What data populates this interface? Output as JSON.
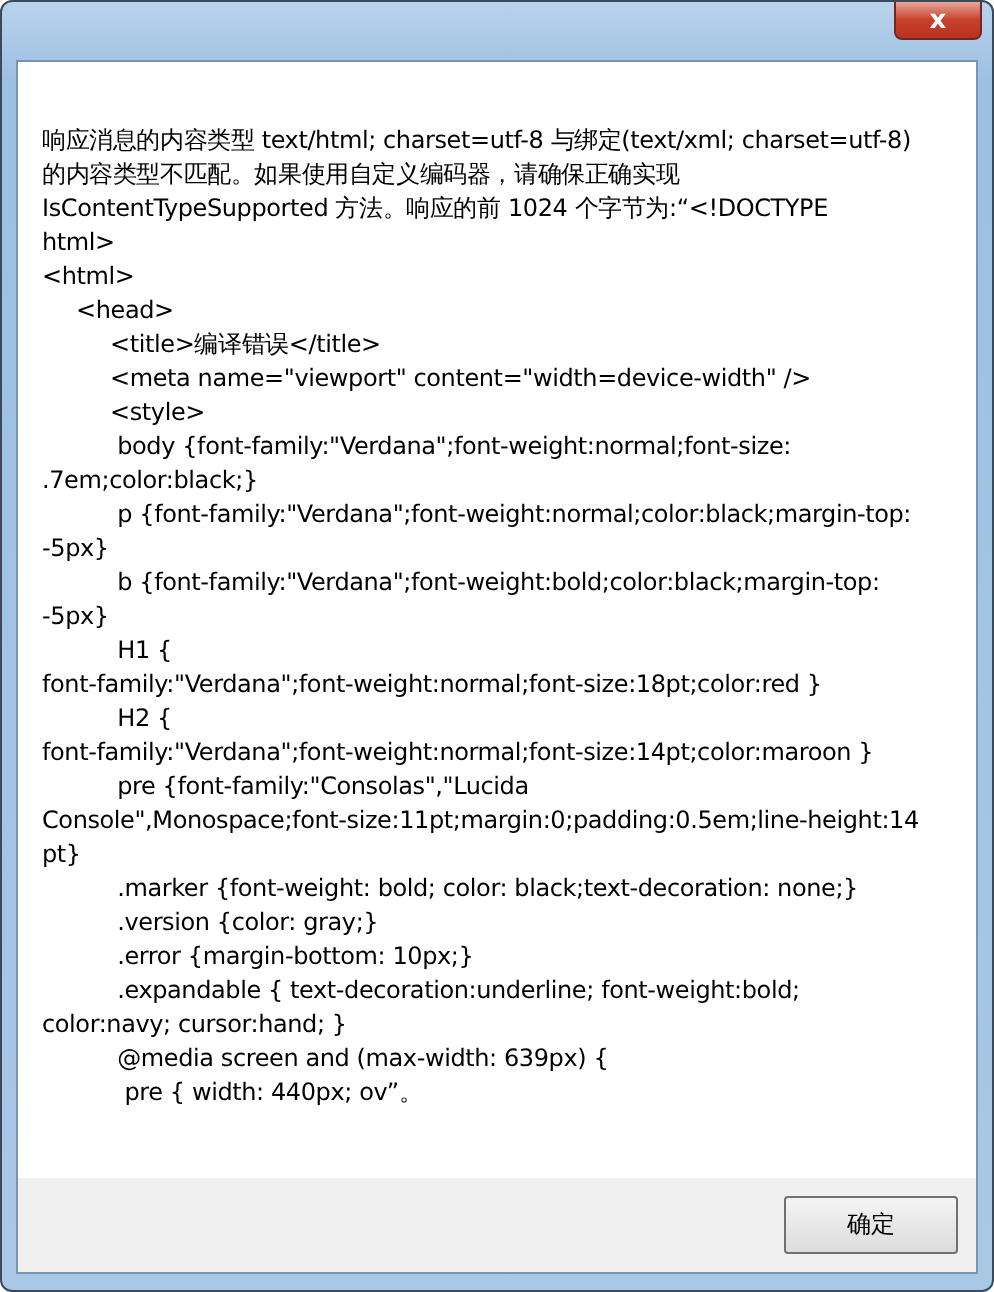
{
  "window": {
    "close_label": "x"
  },
  "message_lines": [
    "响应消息的内容类型 text/html; charset=utf-8 与绑定(text/xml; charset=utf-8)",
    "的内容类型不匹配。如果使用自定义编码器，请确保正确实现",
    "IsContentTypeSupported 方法。响应的前 1024 个字节为:“<!DOCTYPE",
    "html>",
    "<html>",
    "\t<head>",
    "\t\t<title>编译错误</title>",
    "\t\t<meta name=\"viewport\" content=\"width=device-width\" />",
    "\t\t<style>",
    "\t\t body {font-family:\"Verdana\";font-weight:normal;font-size:",
    ".7em;color:black;}",
    "\t\t p {font-family:\"Verdana\";font-weight:normal;color:black;margin-top:",
    "-5px}",
    "\t\t b {font-family:\"Verdana\";font-weight:bold;color:black;margin-top:",
    "-5px}",
    "\t\t H1 {",
    "font-family:\"Verdana\";font-weight:normal;font-size:18pt;color:red }",
    "\t\t H2 {",
    "font-family:\"Verdana\";font-weight:normal;font-size:14pt;color:maroon }",
    "\t\t pre {font-family:\"Consolas\",\"Lucida",
    "Console\",Monospace;font-size:11pt;margin:0;padding:0.5em;line-height:14",
    "pt}",
    "\t\t .marker {font-weight: bold; color: black;text-decoration: none;}",
    "\t\t .version {color: gray;}",
    "\t\t .error {margin-bottom: 10px;}",
    "\t\t .expandable { text-decoration:underline; font-weight:bold;",
    "color:navy; cursor:hand; }",
    "\t\t @media screen and (max-width: 639px) {",
    "\t\t  pre { width: 440px; ov”。"
  ],
  "buttons": [
    {
      "label": "确定"
    }
  ]
}
